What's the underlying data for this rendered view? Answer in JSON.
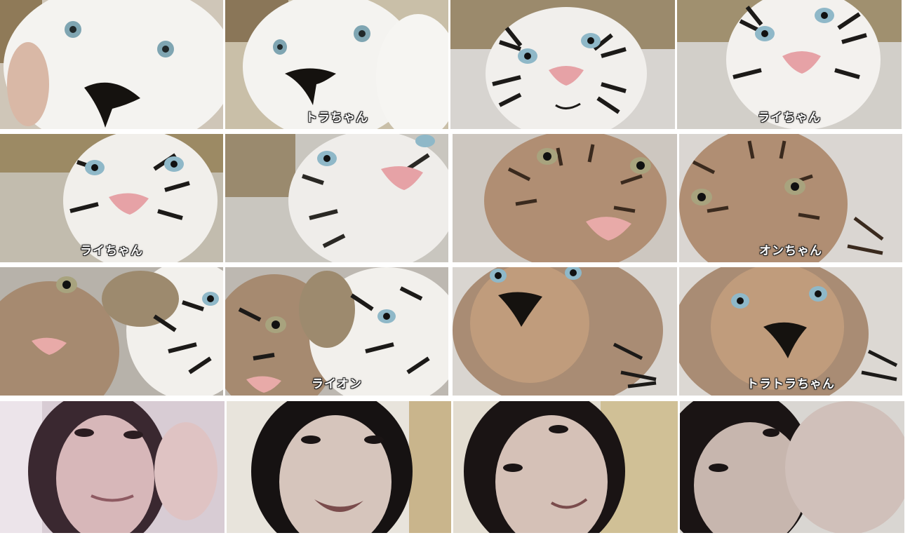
{
  "captions": {
    "r1c2": "トラちゃん",
    "r1c4": "ライちゃん",
    "r2c1": "ライちゃん",
    "r2c4": "オンちゃん",
    "r3c2": "ライオン",
    "r3c4": "トラトラちゃん"
  },
  "colors": {
    "white_tiger_fur": "#f4f2ee",
    "stripe": "#1c1a18",
    "pink_nose": "#e6a2a6",
    "black_nose": "#15120f",
    "brown_tiger": "#b08e73",
    "lion_tan": "#b99376",
    "couch": "#8c7a5e",
    "eye_blue": "#8fb8c8",
    "skin": "#d9c1b6",
    "hair": "#1a1414"
  }
}
